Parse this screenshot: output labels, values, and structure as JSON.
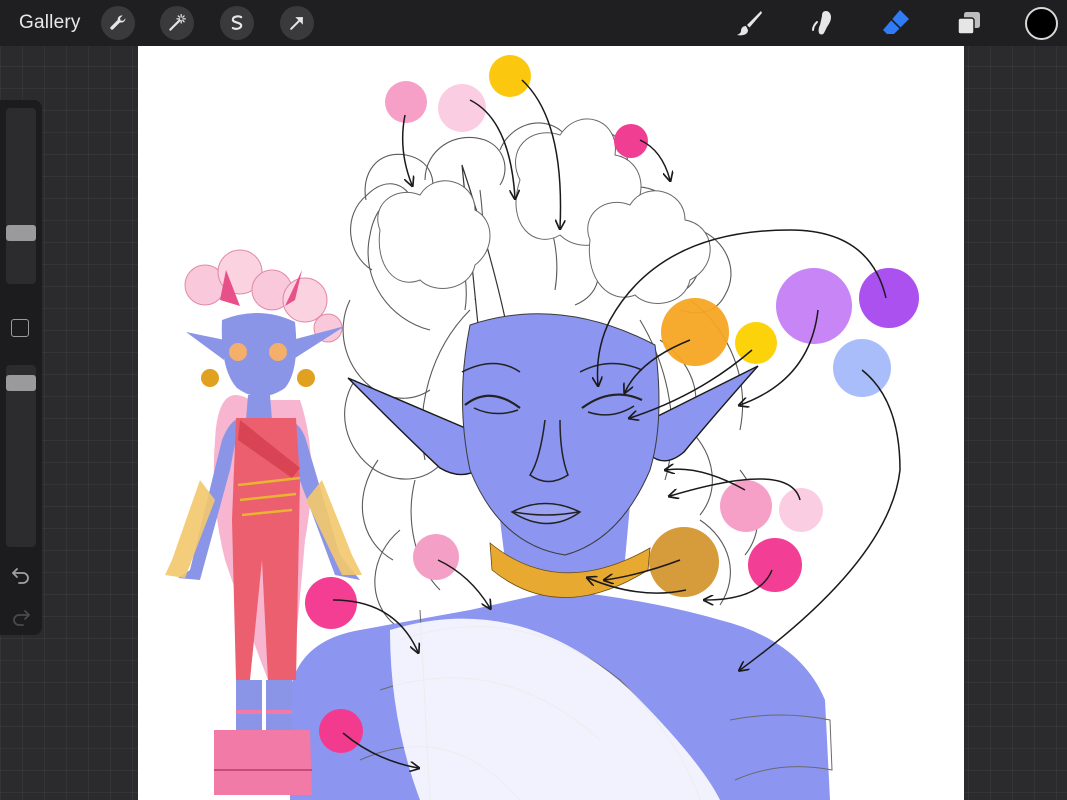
{
  "app": {
    "gallery_label": "Gallery"
  },
  "toolbar": {
    "left_tools": [
      "wrench-icon",
      "magic-wand-icon",
      "selection-icon",
      "transform-arrow-icon"
    ],
    "right_tools": [
      "brush-icon",
      "smudge-icon",
      "eraser-icon",
      "layers-icon"
    ],
    "active_tool": "eraser-icon",
    "accent_color": "#2f7cf6",
    "current_color": "#000000"
  },
  "sidebar": {
    "brush_size_level": 0.27,
    "opacity_level": 0.06,
    "undo_icon": "undo-icon",
    "redo_icon": "redo-icon"
  },
  "palette": {
    "skin": "#8c95f0",
    "gold": "#e8a931",
    "pink": "#f768a9",
    "light_pink": "#f6bcd8",
    "purple": "#b35ef2",
    "yellow": "#fcc70f",
    "light_blue": "#aac0f9"
  }
}
